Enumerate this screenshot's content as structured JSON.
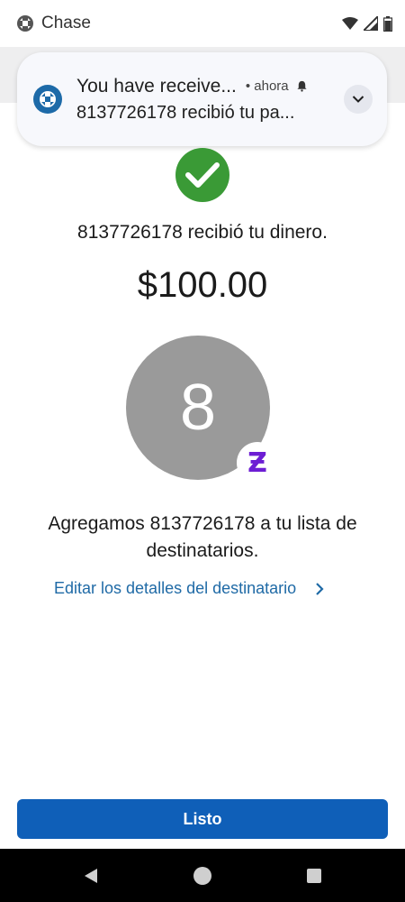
{
  "status_bar": {
    "app_name": "Chase",
    "icons": [
      "chase-logo-icon",
      "wifi-icon",
      "signal-icon",
      "battery-icon"
    ]
  },
  "notification": {
    "icon": "chase-logo-icon",
    "title": "You have receive...",
    "time": "• ahora",
    "body": "8137726178 recibió tu pa...",
    "expand_icon": "chevron-down-icon"
  },
  "confirmation": {
    "status_icon": "check-icon",
    "received_message": "8137726178 recibió tu dinero.",
    "amount": "$100.00"
  },
  "recipient": {
    "avatar_initial": "8",
    "badge_glyph": "Ƶ",
    "added_message": "Agregamos 8137726178 a tu lista de destinatarios.",
    "edit_link_label": "Editar los detalles del destinatario"
  },
  "actions": {
    "done_label": "Listo"
  },
  "colors": {
    "success_green": "#3a9a36",
    "primary_blue": "#0f5fb8",
    "link_blue": "#1f6aa6",
    "zelle_purple": "#6d1ed4",
    "avatar_gray": "#9a9a9a"
  },
  "nav_bar": {
    "buttons": [
      "back-icon",
      "home-icon",
      "recents-icon"
    ]
  }
}
